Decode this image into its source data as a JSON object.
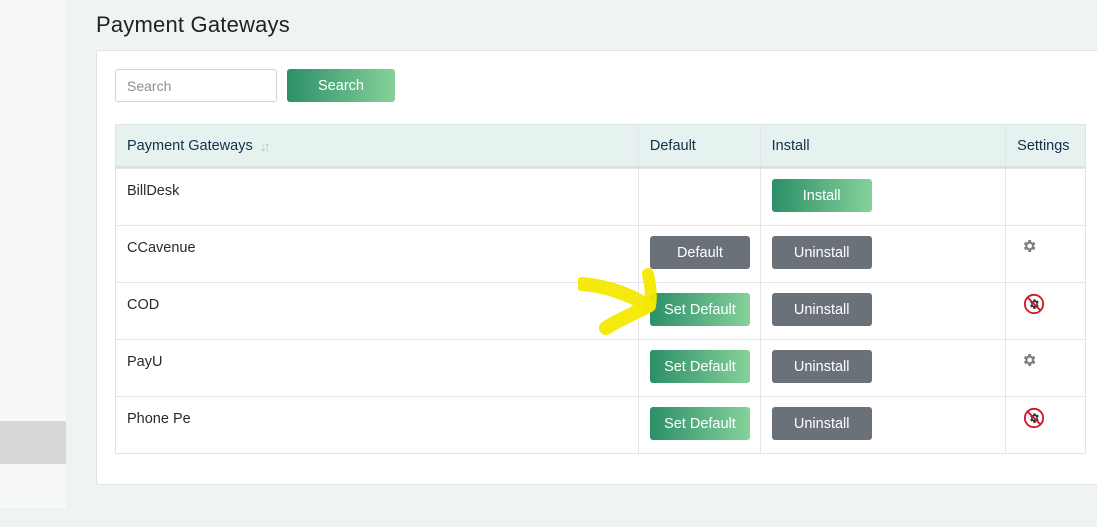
{
  "page": {
    "title": "Payment Gateways"
  },
  "search": {
    "placeholder": "Search",
    "value": "",
    "button_label": "Search"
  },
  "table": {
    "headers": {
      "gateway": "Payment Gateways",
      "default": "Default",
      "install": "Install",
      "settings": "Settings"
    },
    "rows": [
      {
        "name": "BillDesk",
        "default_label": "",
        "install_label": "Install",
        "settings_icon": ""
      },
      {
        "name": "CCavenue",
        "default_label": "Default",
        "install_label": "Uninstall",
        "settings_icon": "gear-icon"
      },
      {
        "name": "COD",
        "default_label": "Set Default",
        "install_label": "Uninstall",
        "settings_icon": "no-settings-icon"
      },
      {
        "name": "PayU",
        "default_label": "Set Default",
        "install_label": "Uninstall",
        "settings_icon": "gear-icon"
      },
      {
        "name": "Phone Pe",
        "default_label": "Set Default",
        "install_label": "Uninstall",
        "settings_icon": "no-settings-icon"
      }
    ]
  },
  "colors": {
    "accent_gradient_start": "#2c8f68",
    "accent_gradient_end": "#86d19a",
    "gray_button": "#6b7178",
    "header_bg": "#e6f2ef",
    "annotation": "#f6e800"
  }
}
